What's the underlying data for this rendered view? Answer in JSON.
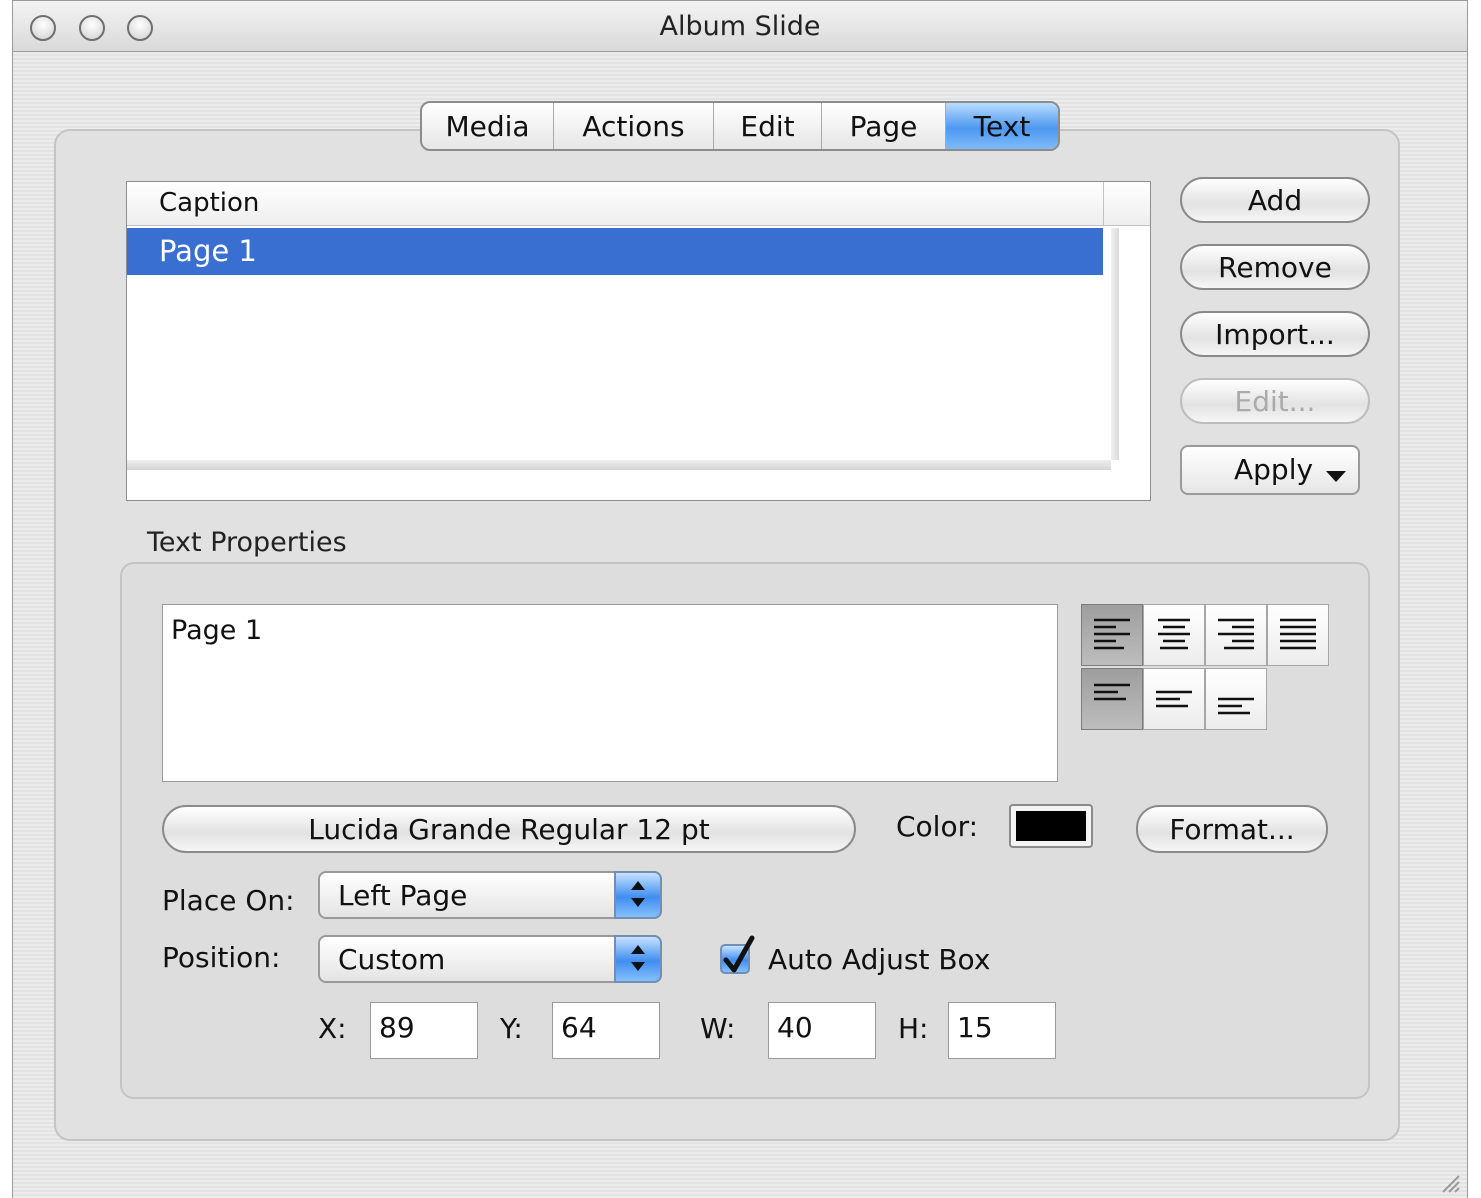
{
  "window": {
    "title": "Album Slide"
  },
  "tabs": [
    {
      "label": "Media"
    },
    {
      "label": "Actions"
    },
    {
      "label": "Edit"
    },
    {
      "label": "Page"
    },
    {
      "label": "Text",
      "active": true
    }
  ],
  "captions": {
    "column_header": "Caption",
    "rows": [
      {
        "label": "Page 1",
        "selected": true
      }
    ]
  },
  "buttons": {
    "add": "Add",
    "remove": "Remove",
    "import": "Import...",
    "edit": "Edit...",
    "apply": "Apply"
  },
  "text_properties": {
    "group_label": "Text Properties",
    "text_value": "Page 1",
    "horizontal_alignment": [
      "left",
      "center",
      "right",
      "justify"
    ],
    "horizontal_selected": "left",
    "vertical_alignment": [
      "top",
      "middle",
      "bottom"
    ],
    "vertical_selected": "top",
    "font_button": "Lucida Grande Regular 12 pt",
    "color_label": "Color:",
    "color_value": "#000000",
    "format_button": "Format...",
    "place_on_label": "Place On:",
    "place_on_value": "Left Page",
    "position_label": "Position:",
    "position_value": "Custom",
    "auto_adjust_label": "Auto Adjust Box",
    "auto_adjust_checked": true,
    "x_label": "X:",
    "x_value": "89",
    "y_label": "Y:",
    "y_value": "64",
    "w_label": "W:",
    "w_value": "40",
    "h_label": "H:",
    "h_value": "15"
  },
  "colors": {
    "selection": "#3a6fd2",
    "accent": "#4d98f0"
  }
}
